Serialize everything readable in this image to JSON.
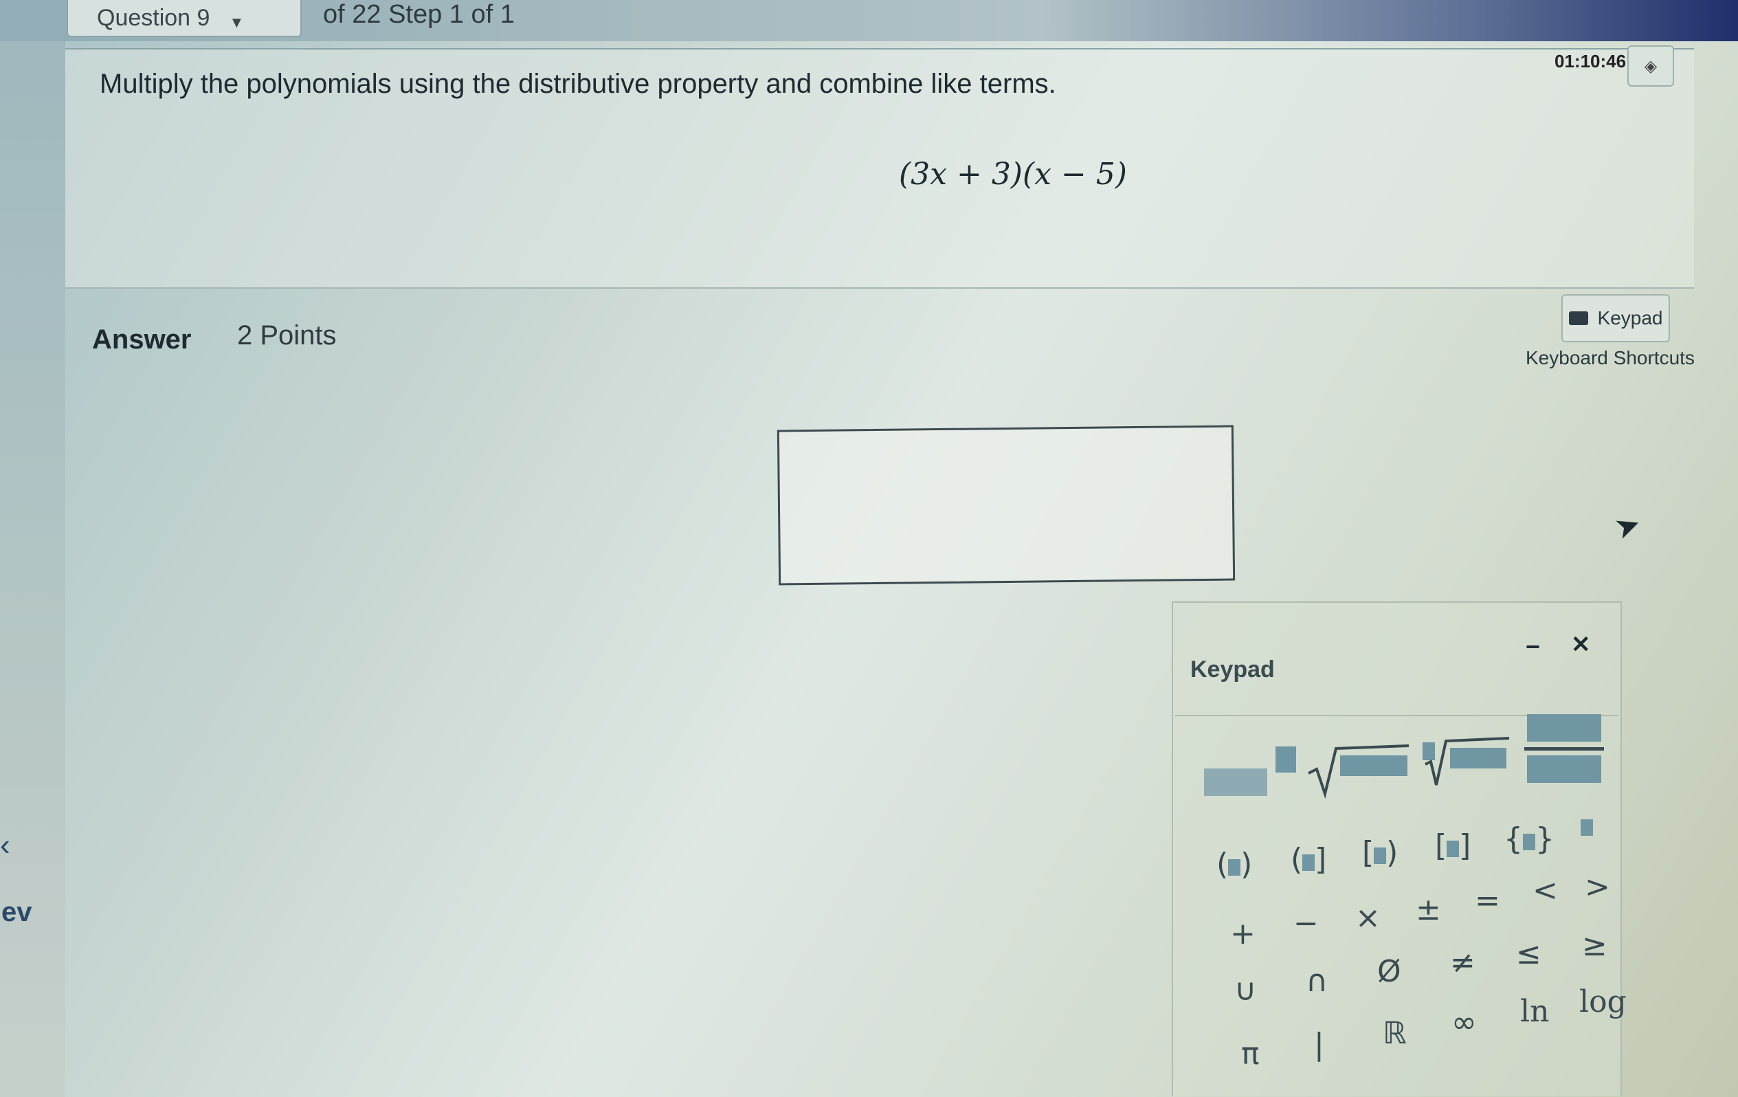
{
  "header": {
    "question_label": "Question 9",
    "step_text": "of 22 Step 1 of 1"
  },
  "timer": {
    "value": "01:10:46",
    "toggle_symbol": "◈"
  },
  "question": {
    "instruction": "Multiply the polynomials using the distributive property and combine like terms.",
    "expression": "(3x + 3)(x − 5)"
  },
  "answer": {
    "label": "Answer",
    "points": "2 Points",
    "value": ""
  },
  "tools": {
    "keypad_label": "Keypad",
    "shortcuts_label": "Keyboard Shortcuts"
  },
  "keypad": {
    "title": "Keypad",
    "minimize": "−",
    "close": "✕",
    "row_operators": [
      "+",
      "−",
      "×",
      "±",
      "=",
      "<",
      ">"
    ],
    "row_sets": [
      "∪",
      "∩",
      "Ø",
      "≠",
      "≤",
      "≥"
    ],
    "row_misc": [
      "π",
      "|",
      "ℝ",
      "∞",
      "ln",
      "log"
    ]
  },
  "sidebar": {
    "partial_text": "ev",
    "chevron": "‹"
  },
  "colors": {
    "accent_block": "#6f96a2",
    "header_dark": "#1f2f6b"
  }
}
